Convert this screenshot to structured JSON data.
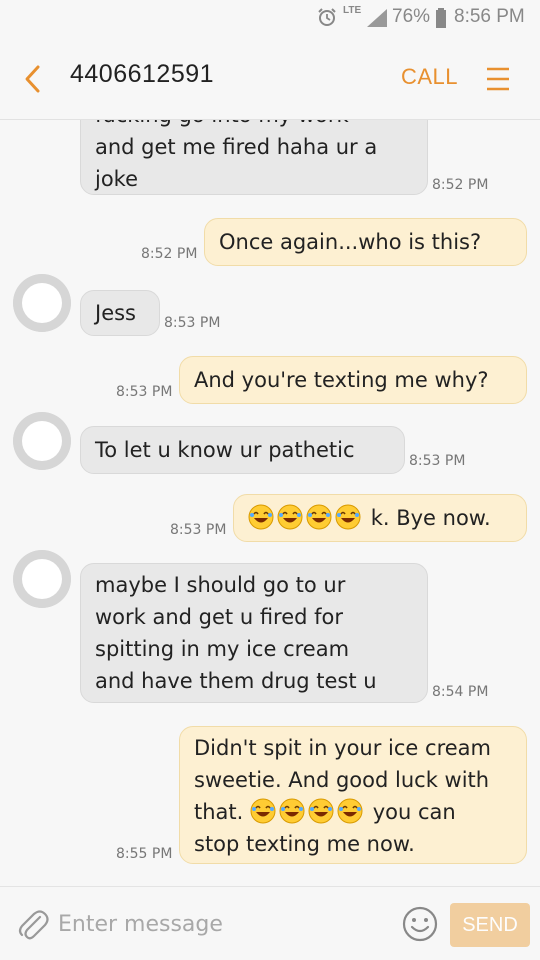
{
  "status_bar": {
    "network": "LTE",
    "battery_percent": "76%",
    "battery_level": 0.76,
    "time": "8:56 PM",
    "icons": [
      "alarm-icon",
      "signal-icon",
      "battery-icon"
    ]
  },
  "header": {
    "contact": "4406612591",
    "call_label": "CALL",
    "icons": [
      "back-arrow-icon",
      "menu-icon"
    ],
    "accent_color": "#e8902f"
  },
  "messages": [
    {
      "dir": "in",
      "lines": [
        "fucking go into my work",
        "and get me fired haha ur a",
        "joke"
      ],
      "time": "8:52 PM"
    },
    {
      "dir": "out",
      "lines": [
        "Once again...who is this?"
      ],
      "time": "8:52 PM"
    },
    {
      "dir": "in",
      "lines": [
        "Jess"
      ],
      "time": "8:53 PM"
    },
    {
      "dir": "out",
      "lines": [
        "And you're texting me why?"
      ],
      "time": "8:53 PM"
    },
    {
      "dir": "in",
      "lines": [
        "To let u know ur pathetic"
      ],
      "time": "8:53 PM"
    },
    {
      "dir": "out",
      "emoji_count": 4,
      "text_after": "k. Bye now.",
      "time": "8:53 PM"
    },
    {
      "dir": "in",
      "lines": [
        "maybe I should go to ur",
        "work and get u fired for",
        "spitting in my ice cream",
        "and have them drug test u"
      ],
      "time": "8:54 PM"
    },
    {
      "dir": "out",
      "lines": [
        "Didn't spit in your ice cream",
        "sweetie. And good luck with",
        "that.",
        "you can",
        "stop texting me now."
      ],
      "emoji_count": 4,
      "time": "8:55 PM"
    }
  ],
  "input": {
    "placeholder": "Enter message",
    "send_label": "SEND",
    "icons": [
      "paperclip-icon",
      "emoji-icon"
    ]
  },
  "colors": {
    "incoming_bubble": "#e8e8e8",
    "outgoing_bubble": "#fdf0d2"
  }
}
